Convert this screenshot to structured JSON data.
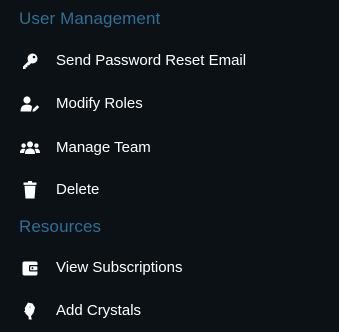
{
  "sections": [
    {
      "title": "User Management",
      "items": [
        {
          "label": "Send Password Reset Email",
          "icon": "key-icon"
        },
        {
          "label": "Modify Roles",
          "icon": "user-edit-icon"
        },
        {
          "label": "Manage Team",
          "icon": "users-icon"
        },
        {
          "label": "Delete",
          "icon": "trash-icon"
        }
      ]
    },
    {
      "title": "Resources",
      "items": [
        {
          "label": "View Subscriptions",
          "icon": "wallet-icon"
        },
        {
          "label": "Add Crystals",
          "icon": "crystal-icon"
        }
      ]
    }
  ],
  "colors": {
    "background": "#0b1115",
    "section_header": "#2e6f96",
    "text": "#ffffff"
  }
}
